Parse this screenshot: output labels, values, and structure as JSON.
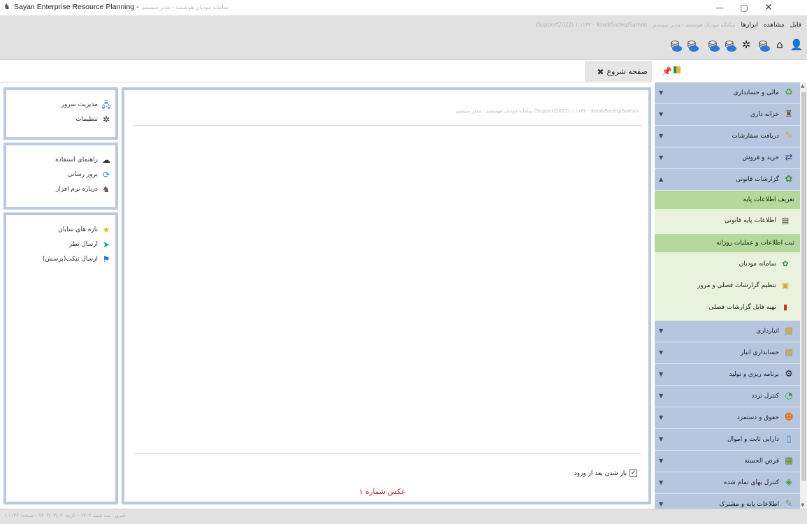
{
  "window": {
    "title": "Sayan Enterprise Resource Planning -",
    "title_blurred": "سامانه مودیان هوشمند - مدیر سیستم",
    "buttons": {
      "minimize": "—",
      "maximize": "▢",
      "close": "✕"
    }
  },
  "menu": {
    "items": [
      "فایل",
      "مشاهده",
      "ابزارها"
    ],
    "blurred_1": "سامانه مودیان هوشمند - مدیر سیستم",
    "blurred_2": "(Support2022) ۱.۱۱۴۲ - Kood/Sadeq/Saman"
  },
  "toolbar": {
    "icons": [
      "user-icon",
      "home-icon",
      "database-add-icon",
      "settings-icon",
      "database-info-icon",
      "database-check-icon",
      "database-remove-icon",
      "database-plus-icon"
    ]
  },
  "tabs": {
    "start_label": "صفحه شروع",
    "close_symbol": "✖"
  },
  "left_panels": {
    "panel1": [
      {
        "label": "مدیریت سرور",
        "icon": "server-icon"
      },
      {
        "label": "تنظیمات",
        "icon": "gear-icon"
      }
    ],
    "panel2": [
      {
        "label": "راهنمای استفاده",
        "icon": "help-icon"
      },
      {
        "label": "بروز رسانی",
        "icon": "update-icon"
      },
      {
        "label": "درباره نرم افزار",
        "icon": "about-icon"
      }
    ],
    "panel3": [
      {
        "label": "تازه های سایان",
        "icon": "star-icon"
      },
      {
        "label": "ارسال نظر",
        "icon": "send-icon"
      },
      {
        "label": "ارسال تیکت(پرسش)",
        "icon": "ticket-icon"
      }
    ]
  },
  "center": {
    "header_blurred": "سامانه مودیان هوشمند - مدیر سیستم (Support2022) ۱.۱۱۴۲ - Kood/Sadeq/Saman",
    "open_after_login_label": "باز شدن بعد از ورود",
    "open_after_login_checked": true,
    "caption": "عکس شماره ۱"
  },
  "nav": {
    "modules_top": [
      {
        "label": "مالی و حسابداری",
        "icon": "finance-icon",
        "expanded": false
      },
      {
        "label": "خزانه داری",
        "icon": "treasury-icon",
        "expanded": false
      },
      {
        "label": "دریافت سفارشات",
        "icon": "orders-icon",
        "expanded": false
      },
      {
        "label": "خرید و فروش",
        "icon": "trade-icon",
        "expanded": false
      },
      {
        "label": "گزارشات قانونی",
        "icon": "legal-reports-icon",
        "expanded": true
      }
    ],
    "expanded_sections": [
      {
        "title": "تعریف اطلاعات پایه",
        "items": [
          {
            "label": "اطلاعات پایه قانونی",
            "icon": "base-info-icon"
          }
        ]
      },
      {
        "title": "ثبت اطلاعات و عملیات روزانه",
        "items": [
          {
            "label": "سامانه مودیان",
            "icon": "taxpayer-icon"
          },
          {
            "label": "تنظیم گزارشات فصلی و مرور",
            "icon": "season-report-icon"
          },
          {
            "label": "تهیه فایل گزارشات فصلی",
            "icon": "report-file-icon"
          }
        ]
      }
    ],
    "modules_bottom": [
      {
        "label": "انبارداری",
        "icon": "warehouse-icon"
      },
      {
        "label": "حسابداری انبار",
        "icon": "warehouse-accounting-icon"
      },
      {
        "label": "برنامه ریزی و تولید",
        "icon": "production-icon"
      },
      {
        "label": "کنترل تردد",
        "icon": "attendance-icon"
      },
      {
        "label": "حقوق و دستمزد",
        "icon": "payroll-icon"
      },
      {
        "label": "دارایی ثابت و اموال",
        "icon": "assets-icon"
      },
      {
        "label": "قرض الحسنه",
        "icon": "loan-icon"
      },
      {
        "label": "کنترل بهای تمام شده",
        "icon": "costing-icon"
      },
      {
        "label": "اطلاعات پایه و مشترک",
        "icon": "common-info-icon"
      }
    ]
  },
  "status": {
    "text_blurred": "امروز: سه شنبه ۱۴۰۲ - تاریخ: ۱۴۰۲/۰۲/۰۲ - نسخه: ۱.۱۱۴۲"
  },
  "colors": {
    "nav_module_bg": "#b6c6df",
    "nav_section_bg": "#b4d99a",
    "nav_subitem_bg": "#e8f2dc",
    "panel_border": "#b9c9df",
    "caption_red": "#c81e1e"
  }
}
